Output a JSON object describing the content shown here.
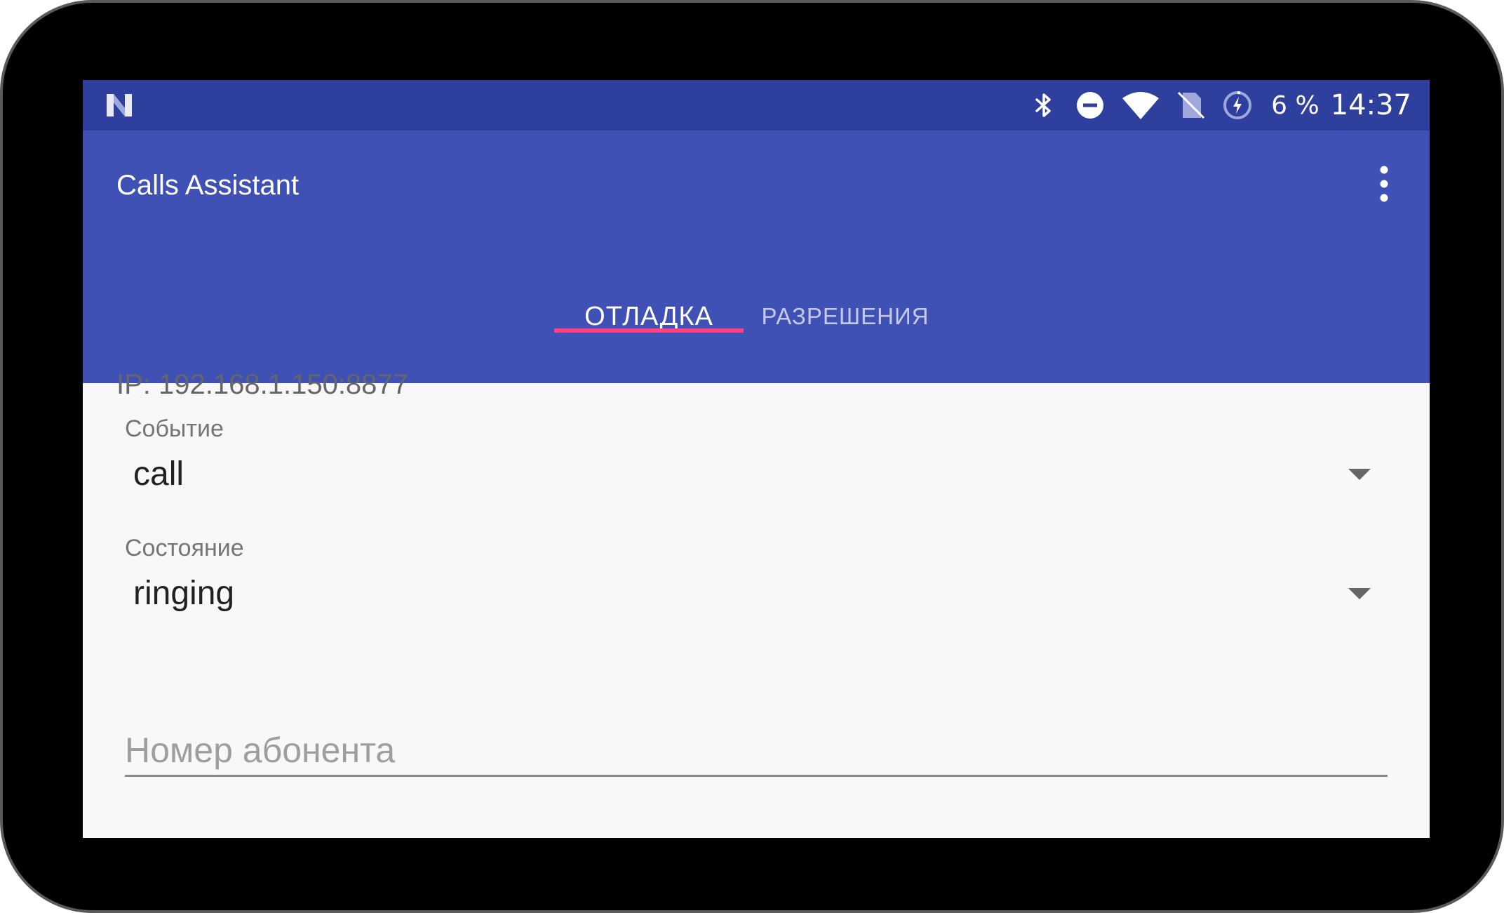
{
  "status_bar": {
    "battery_percent": "6 %",
    "time": "14:37",
    "icons": [
      "notification-n-icon",
      "bluetooth-icon",
      "do-not-disturb-icon",
      "wifi-icon",
      "no-sim-icon",
      "battery-charging-icon"
    ]
  },
  "app_bar": {
    "title": "Calls Assistant",
    "menu_icon": "more-vert-icon"
  },
  "tabs": [
    {
      "label": "ОТЛАДКА",
      "selected": true
    },
    {
      "label": "РАЗРЕШЕНИЯ",
      "selected": false
    }
  ],
  "main": {
    "ip_text": "IP: 192.168.1.150:8877",
    "event": {
      "label": "Событие",
      "value": "call"
    },
    "state": {
      "label": "Состояние",
      "value": "ringing"
    },
    "phone": {
      "placeholder": "Номер абонента",
      "value": ""
    }
  },
  "colors": {
    "primary": "#3f51b5",
    "primary_dark": "#2f3f9e",
    "accent": "#ff4081"
  }
}
